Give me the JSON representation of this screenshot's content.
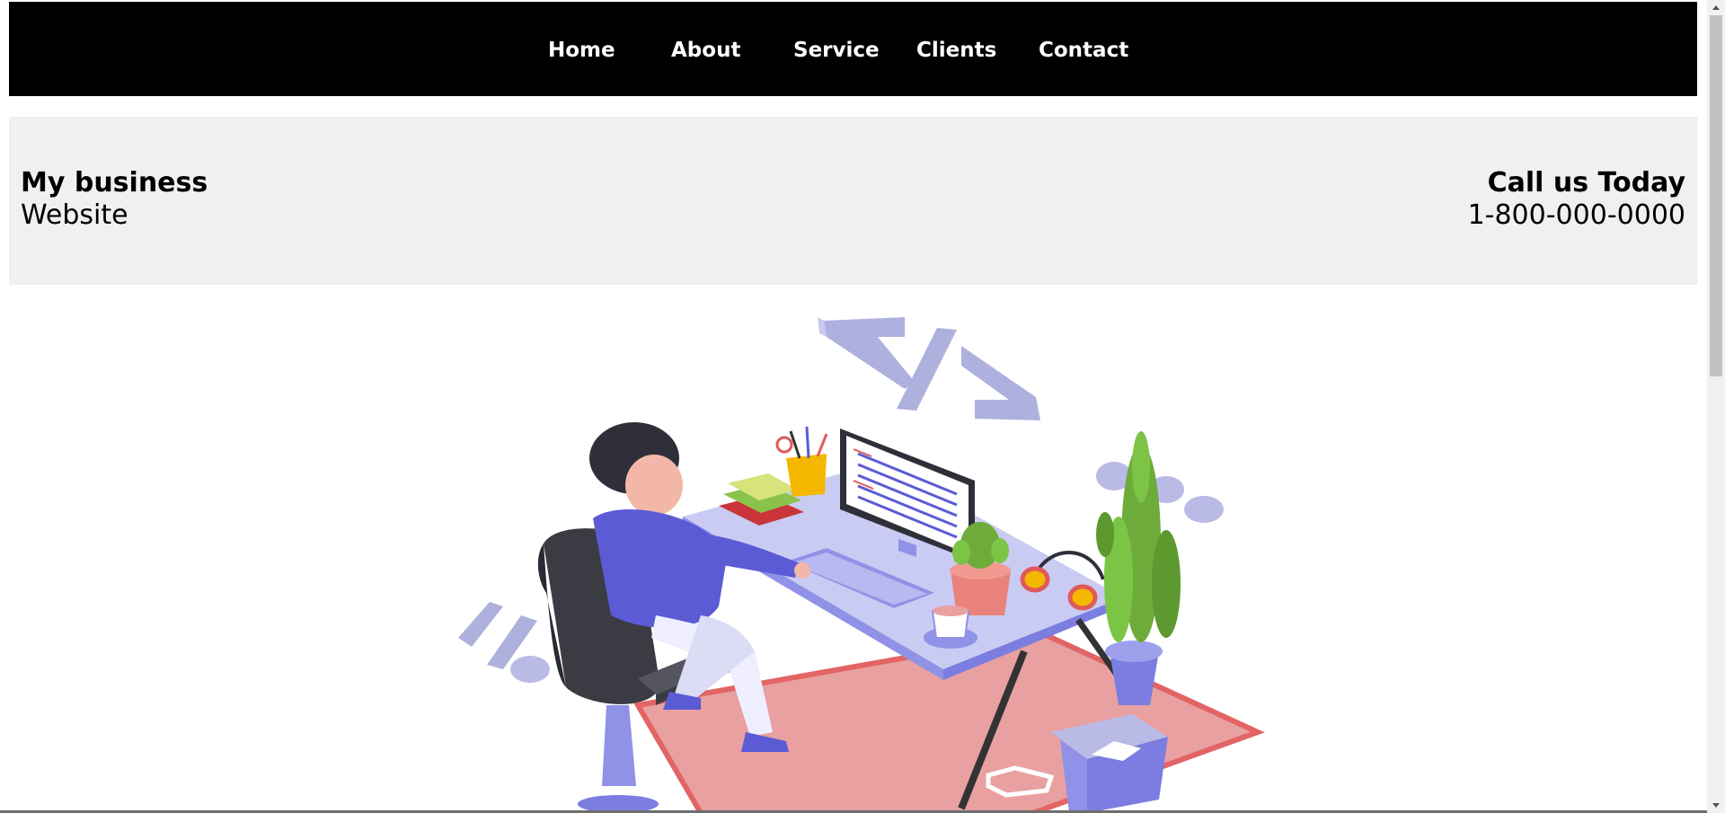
{
  "nav": {
    "items": [
      {
        "label": "Home"
      },
      {
        "label": "About"
      },
      {
        "label": "Service"
      },
      {
        "label": "Clients"
      },
      {
        "label": "Contact"
      }
    ]
  },
  "header": {
    "brand_title": "My business",
    "brand_subtitle": "Website",
    "call_title": "Call us Today",
    "call_number": "1-800-000-0000"
  },
  "hero": {
    "image_icon": "developer-at-desk-illustration",
    "code_symbol": "</>"
  },
  "colors": {
    "nav_bg": "#000000",
    "nav_text": "#ffffff",
    "header_bg": "#f0f0f0",
    "illustration_accent": "#5b5bd6",
    "rug": "#e8a0a0"
  }
}
